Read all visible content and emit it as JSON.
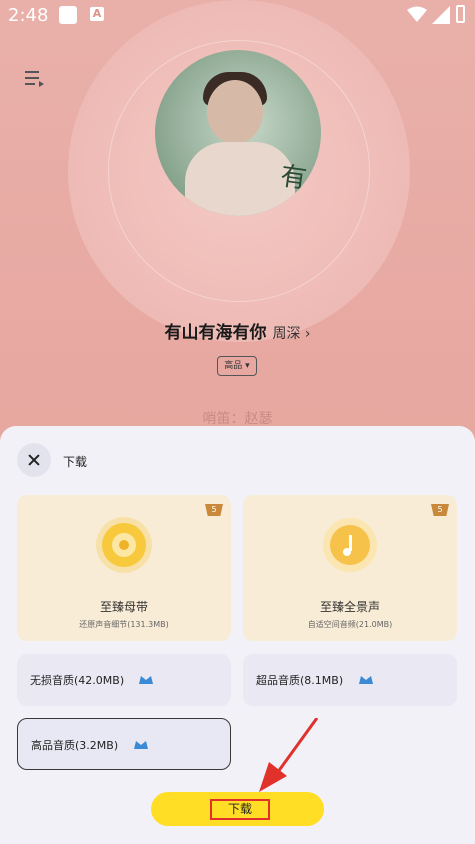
{
  "status_bar": {
    "time": "2:48",
    "notif_letter": "A"
  },
  "player": {
    "song_title": "有山有海有你",
    "artist": "周深",
    "quality": "高品",
    "lyric": "哨笛：赵瑟",
    "cover_text": "有山有海"
  },
  "sheet": {
    "title": "下载",
    "options": [
      {
        "label": "至臻母带",
        "sub": "还原声音细节(131.3MB)",
        "badge": "5"
      },
      {
        "label": "至臻全景声",
        "sub": "自适空间音频(21.0MB)",
        "badge": "5"
      },
      {
        "label": "无损音质(42.0MB)"
      },
      {
        "label": "超品音质(8.1MB)"
      },
      {
        "label": "高品音质(3.2MB)"
      }
    ],
    "download_button": "下载"
  },
  "colors": {
    "accent": "#ffde25",
    "highlight": "#e0312b",
    "gold": "#f3c13a"
  }
}
